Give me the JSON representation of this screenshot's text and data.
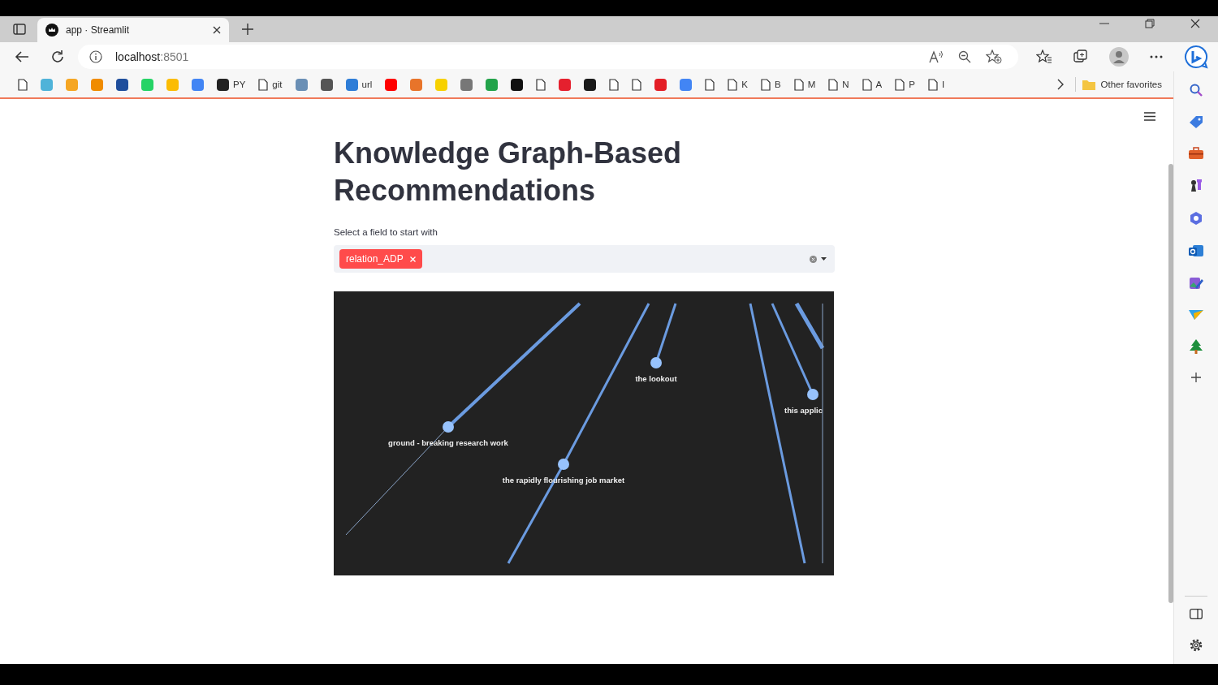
{
  "browser": {
    "tabs": [
      {
        "title": "app · Streamlit",
        "selected": true
      }
    ],
    "address": {
      "host": "localhost",
      "port": ":8501"
    },
    "bookmarks": [
      {
        "kind": "page"
      },
      {
        "kind": "site",
        "color": "#4fb3d9"
      },
      {
        "kind": "site",
        "color": "#f5a623"
      },
      {
        "kind": "site",
        "color": "#f08c00"
      },
      {
        "kind": "site",
        "color": "#1f4e9c"
      },
      {
        "kind": "site",
        "color": "#25d366"
      },
      {
        "kind": "site",
        "color": "#fbbc04"
      },
      {
        "kind": "site",
        "color": "#4285f4"
      },
      {
        "kind": "site",
        "color": "#222222",
        "label": "PY"
      },
      {
        "kind": "page",
        "label": "git"
      },
      {
        "kind": "site",
        "color": "#6a8fb5"
      },
      {
        "kind": "site",
        "color": "#555555"
      },
      {
        "kind": "site",
        "color": "#2e7dd7",
        "label": "url"
      },
      {
        "kind": "site",
        "color": "#ff0000"
      },
      {
        "kind": "site",
        "color": "#e8742a"
      },
      {
        "kind": "site",
        "color": "#f7d100"
      },
      {
        "kind": "site",
        "color": "#777777"
      },
      {
        "kind": "site",
        "color": "#22a34a"
      },
      {
        "kind": "site",
        "color": "#111111"
      },
      {
        "kind": "page"
      },
      {
        "kind": "site",
        "color": "#e5202e"
      },
      {
        "kind": "site",
        "color": "#1a1a1a"
      },
      {
        "kind": "page"
      },
      {
        "kind": "page"
      },
      {
        "kind": "site",
        "color": "#e41e26"
      },
      {
        "kind": "site",
        "color": "#4285f4"
      },
      {
        "kind": "page"
      },
      {
        "kind": "page",
        "label": "K"
      },
      {
        "kind": "page",
        "label": "B"
      },
      {
        "kind": "page",
        "label": "M"
      },
      {
        "kind": "page",
        "label": "N"
      },
      {
        "kind": "page",
        "label": "A"
      },
      {
        "kind": "page",
        "label": "P"
      },
      {
        "kind": "page",
        "label": "I"
      }
    ],
    "other_favorites": "Other favorites"
  },
  "page": {
    "title": "Knowledge Graph-Based Recommendations",
    "select_label": "Select a field to start with",
    "selected_tags": [
      {
        "label": "relation_ADP"
      }
    ],
    "graph": {
      "nodes": [
        {
          "label": "ground - breaking research work"
        },
        {
          "label": "the rapidly flourishing job market"
        },
        {
          "label": "the lookout"
        },
        {
          "label": "this applic"
        }
      ]
    }
  }
}
